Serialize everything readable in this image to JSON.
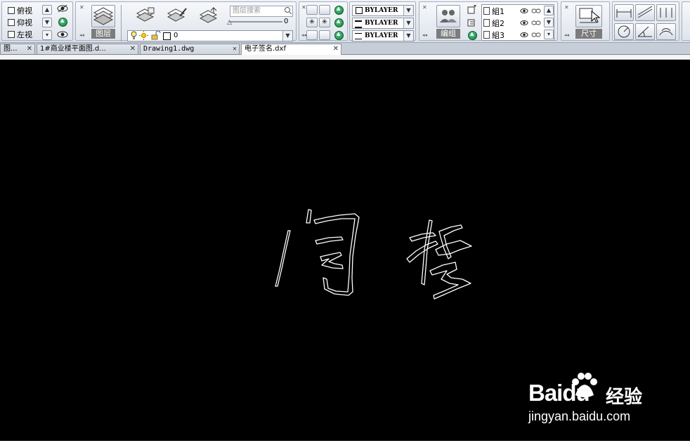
{
  "toolbar": {
    "views": [
      {
        "label": "俯视",
        "icon": "cube-top-icon"
      },
      {
        "label": "仰视",
        "icon": "cube-bottom-icon"
      },
      {
        "label": "左视",
        "icon": "cube-left-icon"
      }
    ],
    "layer_panel_label": "图层",
    "layer_search_placeholder": "图层搜索",
    "layer_slider_value": "0",
    "current_layer": "0",
    "linetype_rows": [
      "BYLAYER",
      "BYLAYER",
      "BYLAYER"
    ],
    "group_panel_label": "编组",
    "groups": [
      "組1",
      "組2",
      "組3"
    ],
    "dimension_panel_label": "尺寸"
  },
  "tabs": [
    {
      "label": "图...",
      "active": false
    },
    {
      "label": "1#商业楼平面图.d...",
      "active": false
    },
    {
      "label": "Drawing1.dwg",
      "active": false
    },
    {
      "label": "电子签名.dxf",
      "active": true
    }
  ],
  "canvas": {
    "background": "#000000",
    "stroke_color": "#ffffff",
    "signature_text": "闫哲"
  },
  "watermark": {
    "brand": "Baidu",
    "suffix": "经验",
    "url": "jingyan.baidu.com"
  }
}
